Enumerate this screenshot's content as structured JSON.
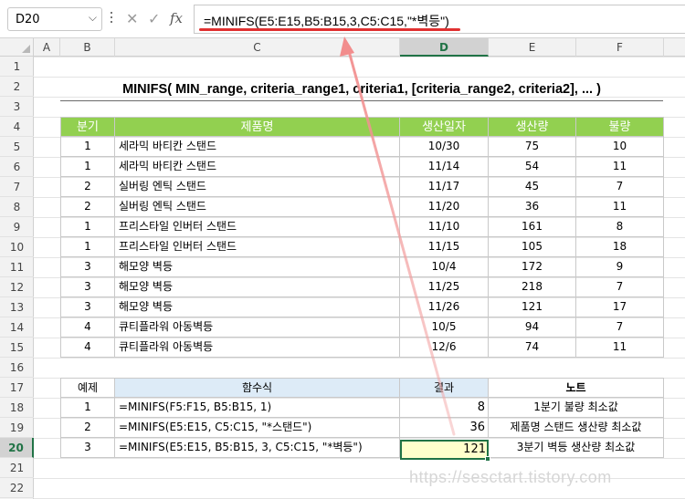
{
  "formula_bar": {
    "name_box": "D20",
    "formula": "=MINIFS(E5:E15,B5:B15,3,C5:C15,\"*벽등\")",
    "cancel_icon": "✕",
    "enter_icon": "✓",
    "fx_icon": "fx"
  },
  "columns": [
    "A",
    "B",
    "C",
    "D",
    "E",
    "F"
  ],
  "selected_column": "D",
  "rows": [
    "1",
    "2",
    "3",
    "4",
    "5",
    "6",
    "7",
    "8",
    "9",
    "10",
    "11",
    "12",
    "13",
    "14",
    "15",
    "16",
    "17",
    "18",
    "19",
    "20",
    "21",
    "22"
  ],
  "selected_row": "20",
  "title": "MINIFS( MIN_range, criteria_range1, criteria1, [criteria_range2, criteria2], ... )",
  "data_table": {
    "headers": [
      "분기",
      "제품명",
      "생산일자",
      "생산량",
      "불량"
    ],
    "rows": [
      [
        "1",
        "세라믹 바티칸 스탠드",
        "10/30",
        "75",
        "10"
      ],
      [
        "1",
        "세라믹 바티칸 스탠드",
        "11/14",
        "54",
        "11"
      ],
      [
        "2",
        "실버링 엔틱 스탠드",
        "11/17",
        "45",
        "7"
      ],
      [
        "2",
        "실버링 엔틱 스탠드",
        "11/20",
        "36",
        "11"
      ],
      [
        "1",
        "프리스타일 인버터 스탠드",
        "11/10",
        "161",
        "8"
      ],
      [
        "1",
        "프리스타일 인버터 스탠드",
        "11/15",
        "105",
        "18"
      ],
      [
        "3",
        "해모양 벽등",
        "10/4",
        "172",
        "9"
      ],
      [
        "3",
        "해모양 벽등",
        "11/25",
        "218",
        "7"
      ],
      [
        "3",
        "해모양 벽등",
        "11/26",
        "121",
        "17"
      ],
      [
        "4",
        "큐티플라워 아동벽등",
        "10/5",
        "94",
        "7"
      ],
      [
        "4",
        "큐티플라워 아동벽등",
        "12/6",
        "74",
        "11"
      ]
    ]
  },
  "example_table": {
    "headers": [
      "예제",
      "함수식",
      "결과",
      "노트"
    ],
    "rows": [
      [
        "1",
        "=MINIFS(F5:F15, B5:B15, 1)",
        "8",
        "1분기 불량 최소값"
      ],
      [
        "2",
        "=MINIFS(E5:E15, C5:C15, \"*스탠드\")",
        "36",
        "제품명 스탠드 생산량 최소값"
      ],
      [
        "3",
        "=MINIFS(E5:E15, B5:B15, 3, C5:C15, \"*벽등\")",
        "121",
        "3분기 벽등 생산량 최소값"
      ]
    ]
  },
  "watermark": "https://sesctart.tistory.com",
  "colors": {
    "header_green": "#92d050",
    "header_blue": "#ddebf7",
    "selection_green": "#217346",
    "selected_fill": "#ffffcc",
    "annotation_red": "#e03030"
  }
}
